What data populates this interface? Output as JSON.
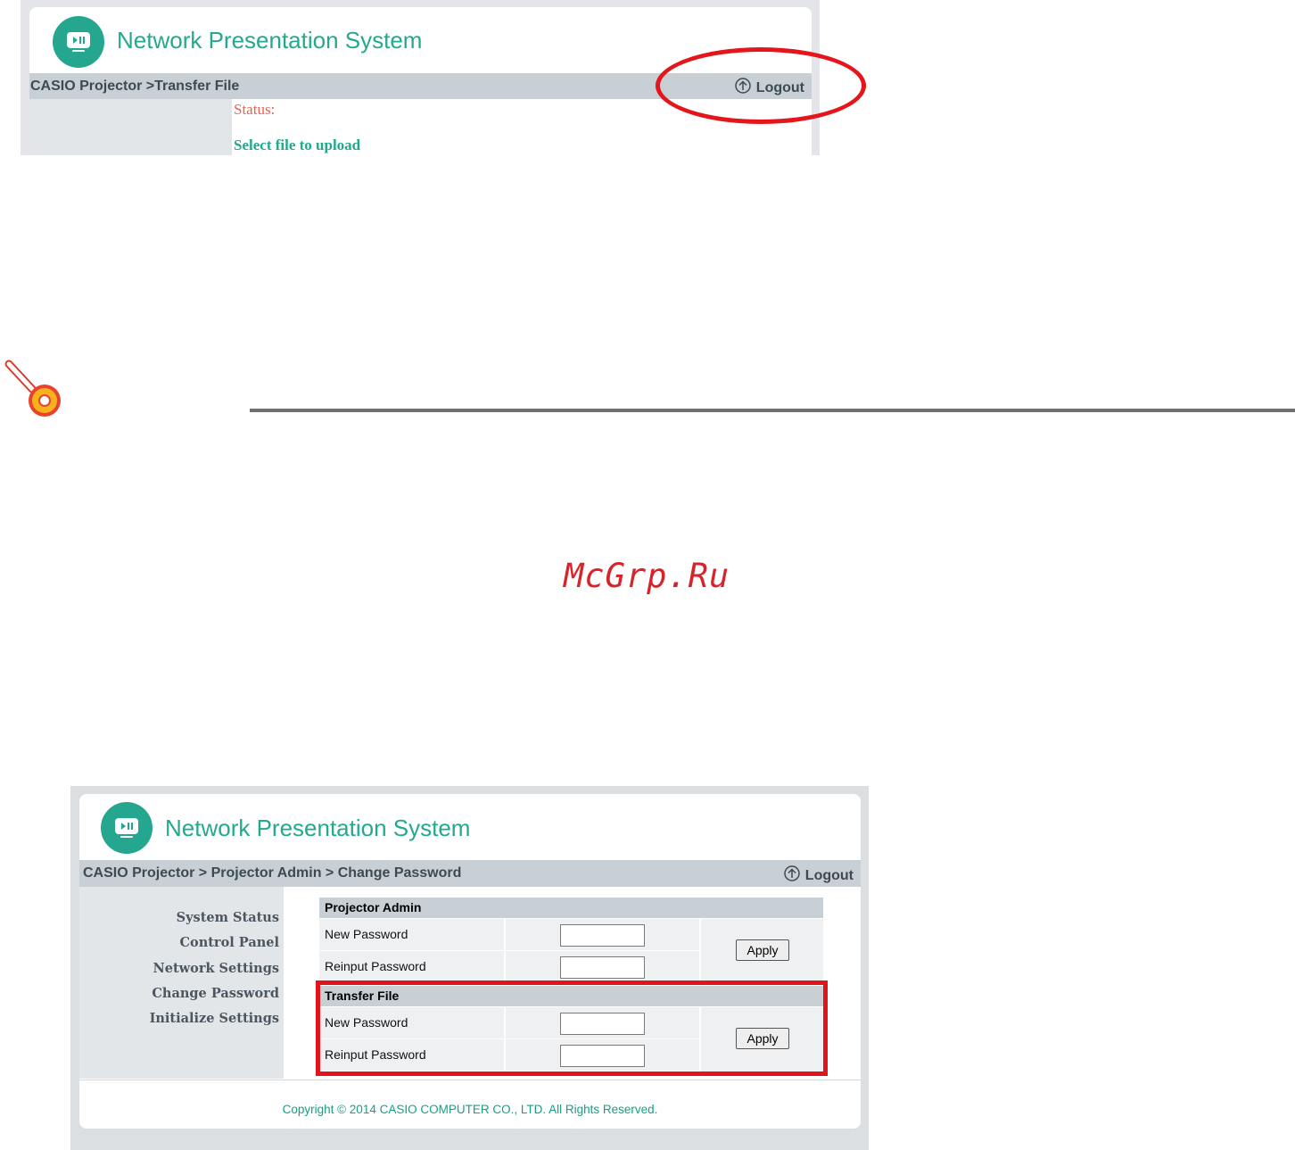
{
  "top_screenshot": {
    "app_title": "Network Presentation System",
    "breadcrumb": "CASIO Projector >Transfer File",
    "logout_label": "Logout",
    "status_label": "Status:",
    "select_label": "Select file to upload"
  },
  "watermark": "McGrp.Ru",
  "bottom_screenshot": {
    "app_title": "Network Presentation System",
    "breadcrumb": "CASIO Projector > Projector Admin > Change Password",
    "logout_label": "Logout",
    "nav": [
      {
        "label": "System Status"
      },
      {
        "label": "Control Panel"
      },
      {
        "label": "Network Settings"
      },
      {
        "label": "Change Password"
      },
      {
        "label": "Initialize Settings"
      }
    ],
    "sections": [
      {
        "title": "Projector Admin",
        "new_password_label": "New Password",
        "reinput_password_label": "Reinput Password",
        "new_password_value": "",
        "reinput_password_value": "",
        "apply_label": "Apply"
      },
      {
        "title": "Transfer File",
        "new_password_label": "New Password",
        "reinput_password_label": "Reinput Password",
        "new_password_value": "",
        "reinput_password_value": "",
        "apply_label": "Apply"
      }
    ],
    "copyright": "Copyright © 2014 CASIO COMPUTER CO., LTD. All Rights Reserved."
  },
  "colors": {
    "brand_green": "#23a98d",
    "breadcrumb_bar": "#c8d0d6",
    "status_red": "#ee5f4f",
    "callout_red": "#e4161b",
    "watermark_red": "#d9232b"
  },
  "icons": {
    "app_logo": "projector-play-pause-icon",
    "logout": "arrow-up-circle-icon",
    "tip": "tip-pin-icon"
  }
}
